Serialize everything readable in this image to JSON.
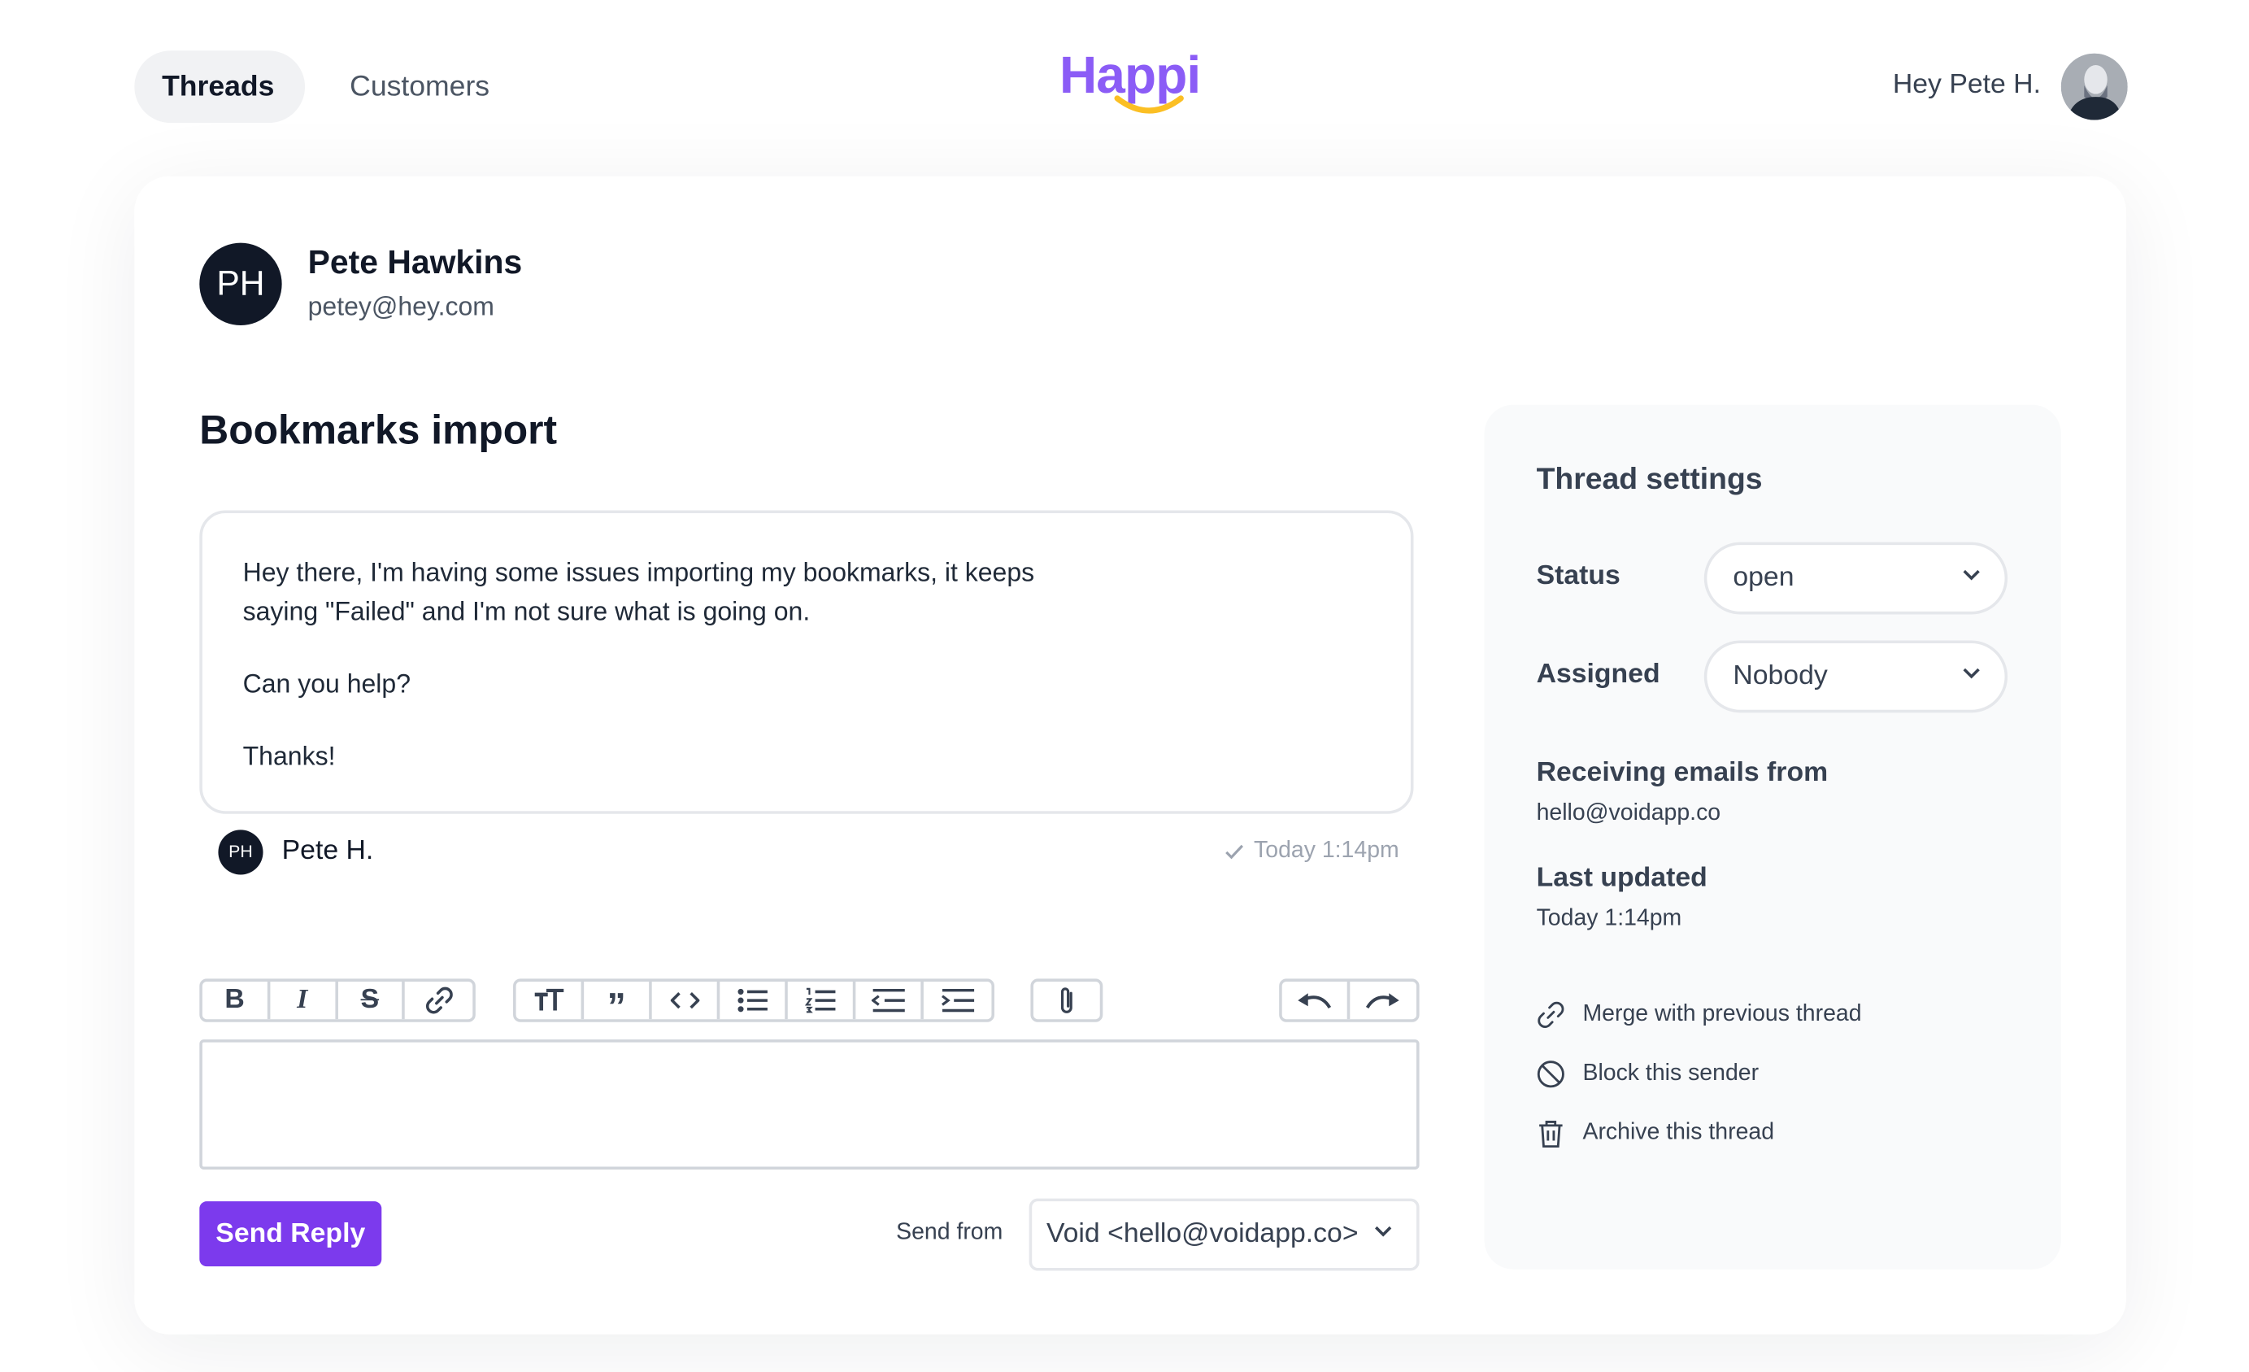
{
  "nav": {
    "tabs": [
      {
        "label": "Threads",
        "active": true
      },
      {
        "label": "Customers",
        "active": false
      }
    ],
    "logo_text": "Happi",
    "greeting": "Hey Pete H."
  },
  "customer": {
    "initials": "PH",
    "name": "Pete Hawkins",
    "email": "petey@hey.com"
  },
  "thread": {
    "subject": "Bookmarks import",
    "message": {
      "line1": "Hey there, I'm having some issues importing my bookmarks, it keeps",
      "line2": "saying \"Failed\" and I'm not sure what is going on.",
      "line3": "Can you help?",
      "line4": "Thanks!"
    },
    "author_initials": "PH",
    "author": "Pete H.",
    "time": "Today 1:14pm"
  },
  "editor": {
    "toolbar": [
      "bold-icon",
      "italic-icon",
      "strikethrough-icon",
      "link-icon",
      "heading-icon",
      "quote-icon",
      "code-icon",
      "bullet-list-icon",
      "numbered-list-icon",
      "outdent-icon",
      "indent-icon",
      "attachment-icon",
      "undo-icon",
      "redo-icon"
    ],
    "reply_value": "",
    "send_label": "Send Reply",
    "send_from_label": "Send from",
    "send_from_value": "Void <hello@voidapp.co>"
  },
  "settings": {
    "title": "Thread settings",
    "status_label": "Status",
    "status_value": "open",
    "assigned_label": "Assigned",
    "assigned_value": "Nobody",
    "receiving_label": "Receiving emails from",
    "receiving_value": "hello@voidapp.co",
    "updated_label": "Last updated",
    "updated_value": "Today 1:14pm",
    "actions": {
      "merge": "Merge with previous thread",
      "block": "Block this sender",
      "archive": "Archive this thread"
    }
  },
  "colors": {
    "accent": "#7c3aed",
    "logo": "#8b5cf6",
    "smile": "#fbbf24"
  }
}
